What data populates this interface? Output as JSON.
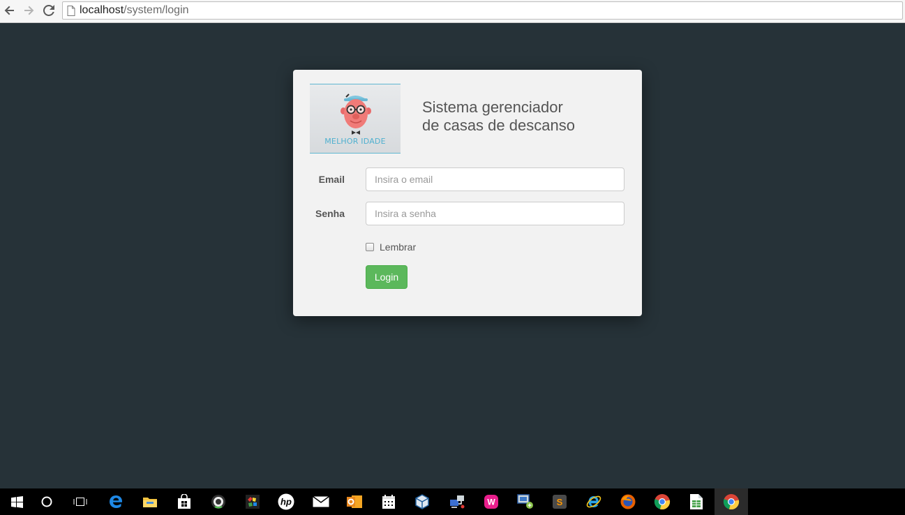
{
  "browser": {
    "url_host": "localhost",
    "url_path": "/system/login"
  },
  "login": {
    "logo_text": "MELHOR IDADE",
    "title_line1": "Sistema gerenciador",
    "title_line2": "de casas de descanso",
    "email_label": "Email",
    "email_placeholder": "Insira o email",
    "password_label": "Senha",
    "password_placeholder": "Insira a senha",
    "remember_label": "Lembrar",
    "login_button": "Login"
  },
  "colors": {
    "page_background": "#263238",
    "card_background": "#f2f2f2",
    "button_green": "#5cb85c",
    "logo_accent": "#4fb0cf"
  },
  "taskbar": {
    "items": [
      "windows-start-icon",
      "cortana-icon",
      "task-view-icon",
      "edge-icon",
      "file-explorer-icon",
      "store-icon",
      "camera-app-icon",
      "color-app-icon",
      "hp-icon",
      "mail-icon",
      "outlook-icon",
      "calendar-icon",
      "virtualbox-icon",
      "network-app-icon",
      "wamp-icon",
      "remote-desktop-icon",
      "sublime-text-icon",
      "internet-explorer-icon",
      "firefox-icon",
      "chrome-icon",
      "spreadsheet-icon",
      "chrome-active-icon"
    ]
  }
}
